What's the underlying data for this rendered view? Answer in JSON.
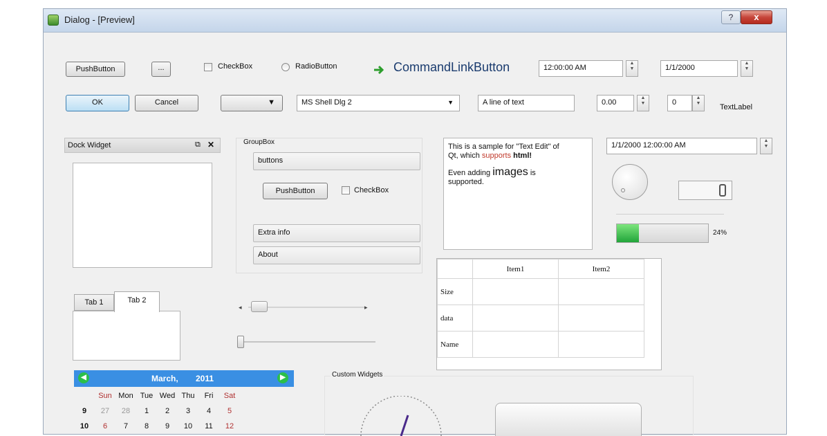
{
  "window": {
    "title": "Dialog - [Preview]",
    "help_label": "?",
    "close_label": "x"
  },
  "row1": {
    "pushbutton_label": "PushButton",
    "ellipsis_label": "...",
    "checkbox_label": "CheckBox",
    "radio_label": "RadioButton",
    "commandlink_label": "CommandLinkButton",
    "time_value": "12:00:00 AM",
    "date_value": "1/1/2000"
  },
  "row2": {
    "ok_label": "OK",
    "cancel_label": "Cancel",
    "font_combo_value": "MS Shell Dlg 2",
    "line_edit_value": "A line of text",
    "double_spin_value": "0.00",
    "spin_value": "0",
    "text_label": "TextLabel"
  },
  "dock": {
    "title": "Dock Widget"
  },
  "groupbox": {
    "title": "GroupBox",
    "buttons_label": "buttons",
    "pushbutton_label": "PushButton",
    "checkbox_label": "CheckBox",
    "extra_label": "Extra info",
    "about_label": "About"
  },
  "textedit": {
    "line1": "This is a sample for \"Text Edit\" of",
    "line2_prefix": "Qt, which ",
    "line2_colored": "supports",
    "line2_bold": "html!",
    "line3_prefix": "Even adding ",
    "line3_big": "images",
    "line3_suffix": " is",
    "line4": "supported.",
    "accent_color": "#c0392b"
  },
  "datetime": {
    "value": "1/1/2000 12:00:00 AM"
  },
  "progress": {
    "value": 24,
    "label": "24%"
  },
  "tabs": {
    "tab1": "Tab 1",
    "tab2": "Tab 2"
  },
  "table": {
    "headers": [
      "Item1",
      "Item2"
    ],
    "rows": [
      "Size",
      "data",
      "Name"
    ]
  },
  "calendar": {
    "month": "March,",
    "year": "2011",
    "header_color": "#3a8fe3",
    "days": [
      "Sun",
      "Mon",
      "Tue",
      "Wed",
      "Thu",
      "Fri",
      "Sat"
    ],
    "weeks": [
      {
        "num": "9",
        "dates": [
          "27",
          "28",
          "1",
          "2",
          "3",
          "4",
          "5"
        ]
      },
      {
        "num": "10",
        "dates": [
          "6",
          "7",
          "8",
          "9",
          "10",
          "11",
          "12"
        ]
      }
    ]
  },
  "custom": {
    "title": "Custom Widgets"
  }
}
